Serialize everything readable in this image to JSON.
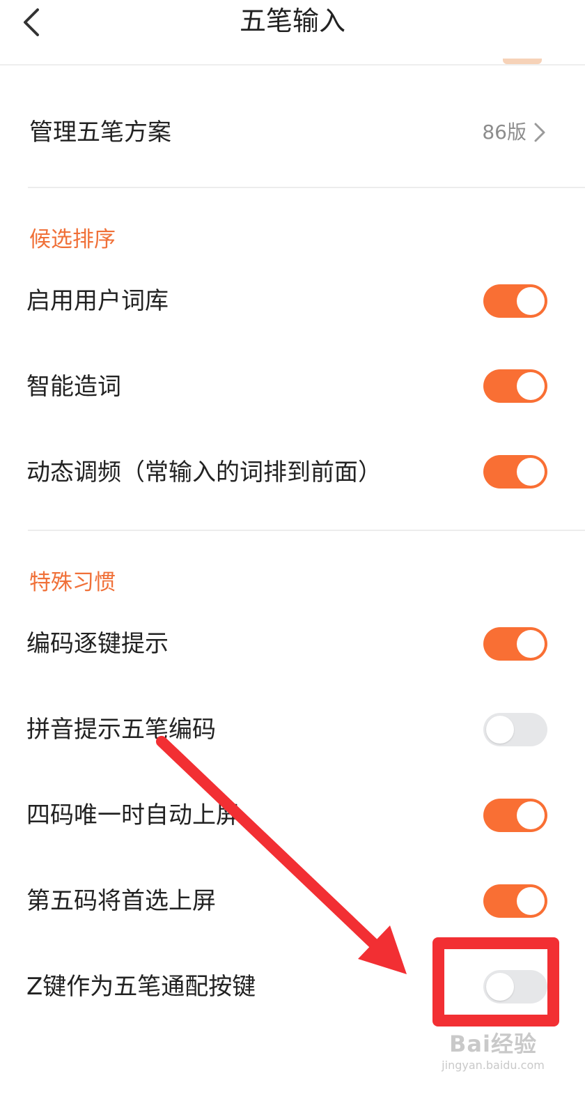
{
  "header": {
    "title": "五笔输入",
    "back_icon": "chevron-left-icon"
  },
  "manage_scheme": {
    "label": "管理五笔方案",
    "value": "86版",
    "chevron_icon": "chevron-right-icon"
  },
  "sections": [
    {
      "title": "候选排序",
      "items": [
        {
          "label": "启用用户词库",
          "enabled": true
        },
        {
          "label": "智能造词",
          "enabled": true
        },
        {
          "label": "动态调频（常输入的词排到前面）",
          "enabled": true
        }
      ]
    },
    {
      "title": "特殊习惯",
      "items": [
        {
          "label": "编码逐键提示",
          "enabled": true
        },
        {
          "label": "拼音提示五笔编码",
          "enabled": false
        },
        {
          "label": "四码唯一时自动上屏",
          "enabled": true
        },
        {
          "label": "第五码将首选上屏",
          "enabled": true
        },
        {
          "label": "Z键作为五笔通配按键",
          "enabled": false
        }
      ]
    }
  ],
  "annotation": {
    "arrow_color": "#f22f33",
    "box_color": "#f22f33"
  },
  "watermark": {
    "brand": "Bai经验",
    "url": "jingyan.baidu.com",
    "icon": "paw-icon"
  },
  "colors": {
    "accent": "#f96f34",
    "section_title": "#f07038",
    "toggle_off": "#e6e7e9"
  }
}
